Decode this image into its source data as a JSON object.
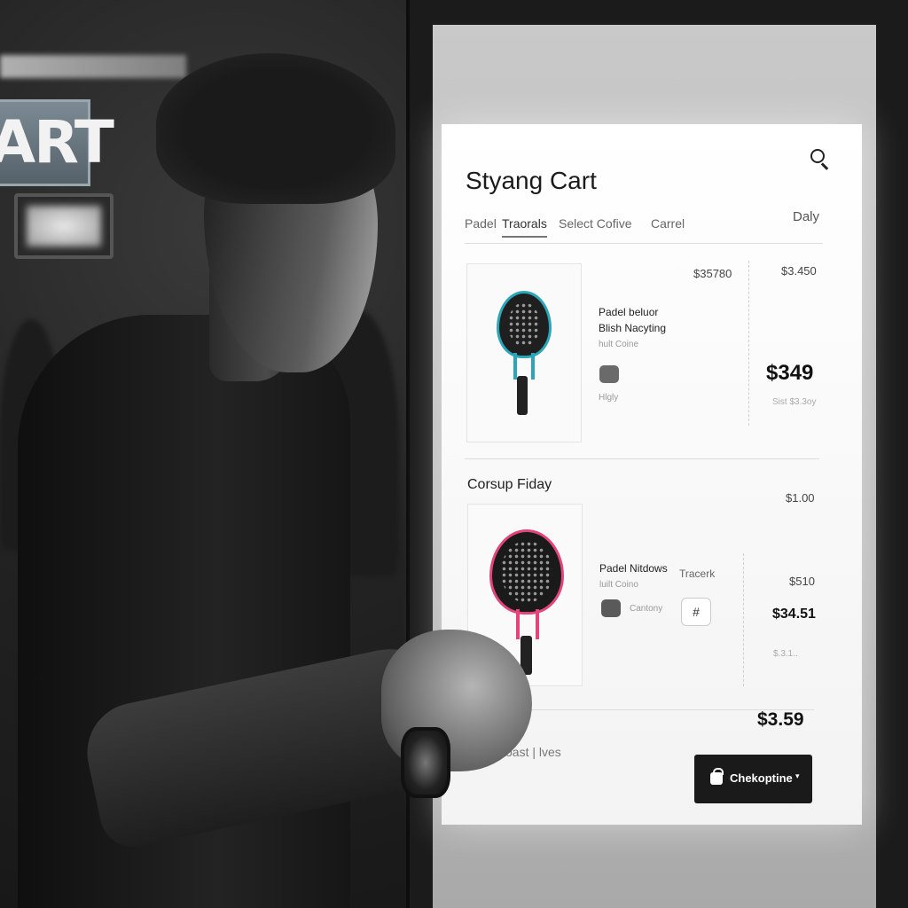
{
  "background": {
    "store_sign_text": "ART"
  },
  "screen": {
    "title": "Styang Cart",
    "search_icon": "search-icon",
    "tabs": [
      {
        "label": "Padel"
      },
      {
        "label": "Traorals",
        "active": true
      },
      {
        "label": "Select Cofive"
      },
      {
        "label": "Carrel"
      }
    ],
    "tab_right_label": "Daly",
    "items": [
      {
        "price_top_left": "$35780",
        "price_top_right": "$3.450",
        "name_line1": "Padel beluor",
        "name_line2": "Blish Nacyting",
        "meta": "hult Coine",
        "meta2": "Hlgly",
        "price": "$349",
        "strike_price": "Sist $3.3oy",
        "racket_colors": {
          "face": "#1f1f1f",
          "accent": "#2aa6b8"
        }
      },
      {
        "section_title": "Corsup Fiday",
        "section_price": "$1.00",
        "name_line1": "Padel Nitdows",
        "name_extra": "Tracerk",
        "meta": "luilt Coino",
        "meta2": "Cantony",
        "qty_icon": "#",
        "price_small": "$510",
        "price": "$34.51",
        "strike_price": "$.3.1..",
        "racket_colors": {
          "face": "#1a1a1a",
          "accent": "#e3447a"
        }
      }
    ],
    "footer": {
      "left_text": "oast | lves",
      "total": "$3.59",
      "checkout_label": "Chekoptine",
      "caret": "▾"
    }
  }
}
